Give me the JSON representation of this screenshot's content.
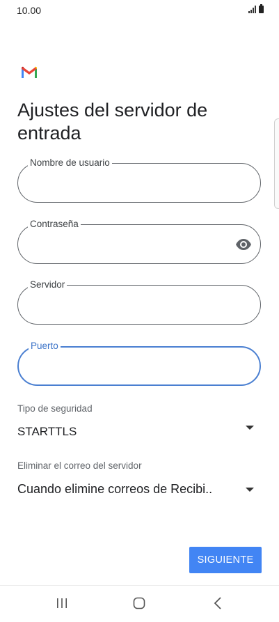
{
  "status_bar": {
    "time": "10.00"
  },
  "page": {
    "title": "Ajustes del servidor de entrada"
  },
  "fields": {
    "username": {
      "label": "Nombre de usuario",
      "value": ""
    },
    "password": {
      "label": "Contraseña",
      "value": ""
    },
    "server": {
      "label": "Servidor",
      "value": ""
    },
    "port": {
      "label": "Puerto",
      "value": ""
    }
  },
  "security": {
    "label": "Tipo de seguridad",
    "value": "STARTTLS"
  },
  "delete_from_server": {
    "label": "Eliminar el correo del servidor",
    "value": "Cuando elimine correos de Recibi.."
  },
  "actions": {
    "next_label": "SIGUIENTE"
  },
  "colors": {
    "accent": "#4285f4",
    "focus_border": "#4a7fd1"
  },
  "icons": [
    "gmail-logo-icon",
    "eye-icon",
    "dropdown-arrow-icon",
    "recent-apps-icon",
    "home-icon",
    "back-icon"
  ]
}
